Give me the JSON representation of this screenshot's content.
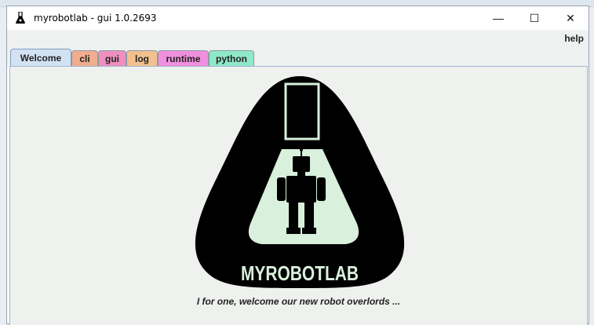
{
  "window": {
    "title": "myrobotlab - gui 1.0.2693",
    "minimize_glyph": "—",
    "maximize_glyph": "☐",
    "close_glyph": "✕"
  },
  "menubar": {
    "help": "help"
  },
  "tabs": [
    {
      "label": "Welcome",
      "color": "#d3e2f3",
      "active": true
    },
    {
      "label": "cli",
      "color": "#f0ad8f",
      "active": false
    },
    {
      "label": "gui",
      "color": "#ef8fbd",
      "active": false
    },
    {
      "label": "log",
      "color": "#f3c08f",
      "active": false
    },
    {
      "label": "runtime",
      "color": "#f08fde",
      "active": false
    },
    {
      "label": "python",
      "color": "#8fe8c8",
      "active": false
    }
  ],
  "welcome": {
    "logo_text": "MYROBOTLAB",
    "tagline": "I for one, welcome our new robot overlords ..."
  },
  "colors": {
    "logo_dark": "#000000",
    "logo_light": "#d8f0dc",
    "content_bg": "#eef1ee"
  },
  "icons": [
    "flask-icon",
    "minimize-icon",
    "maximize-icon",
    "close-icon",
    "myrobotlab-logo"
  ]
}
